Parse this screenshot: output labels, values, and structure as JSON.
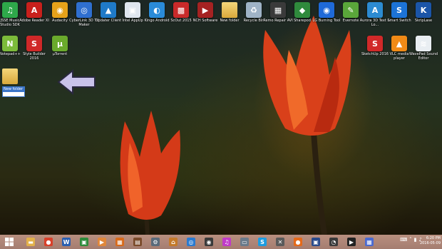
{
  "desktop_icons": [
    {
      "label": "JSSE Music Studio SDK",
      "icon": "music-app-icon",
      "color": "#2ea84a",
      "glyph": "♫"
    },
    {
      "label": "Adobe Reader XI",
      "icon": "adobe-reader-icon",
      "color": "#c8201c",
      "glyph": "A"
    },
    {
      "label": "Audacity",
      "icon": "audacity-icon",
      "color": "#e6a21a",
      "glyph": "◉"
    },
    {
      "label": "CyberLink 3D TV Maker",
      "icon": "cyberlink-icon",
      "color": "#2f6fd0",
      "glyph": "◎"
    },
    {
      "label": "Updater Client",
      "icon": "updater-icon",
      "color": "#1f7ac8",
      "glyph": "▲"
    },
    {
      "label": "Intel AppUp",
      "icon": "intel-icon",
      "color": "#dfe6ef",
      "glyph": "▣"
    },
    {
      "label": "Kingo Android",
      "icon": "kingo-icon",
      "color": "#2a8bd8",
      "glyph": "◐"
    },
    {
      "label": "ScOut 2015",
      "icon": "scout-icon",
      "color": "#c92a2a",
      "glyph": "▩"
    },
    {
      "label": "NCH Software",
      "icon": "nch-icon",
      "color": "#a52222",
      "glyph": "▶"
    },
    {
      "label": "New folder",
      "icon": "folder-icon",
      "color": "#e2b04a",
      "glyph": ""
    },
    {
      "label": "Recycle Bin",
      "icon": "recycle-bin-icon",
      "color": "#9fb3c6",
      "glyph": "♻"
    },
    {
      "label": "Remo Repair AVI",
      "icon": "remo-repair-icon",
      "color": "#3a3a3a",
      "glyph": "▦"
    },
    {
      "label": "Sharepod",
      "icon": "sharepod-icon",
      "color": "#2f8a3c",
      "glyph": "◆"
    },
    {
      "label": "LG Burning Tool",
      "icon": "lg-burning-icon",
      "color": "#1f6ad8",
      "glyph": "◉"
    },
    {
      "label": "Evernote",
      "icon": "evernote-icon",
      "color": "#5aa63a",
      "glyph": "✎"
    },
    {
      "label": "Aurora 3D Text & Lo...",
      "icon": "aurora-3d-icon",
      "color": "#2c8bd2",
      "glyph": "A"
    },
    {
      "label": "Smart Switch",
      "icon": "smart-switch-icon",
      "color": "#1c73d6",
      "glyph": "S"
    },
    {
      "label": "SkripLase",
      "icon": "skriplase-icon",
      "color": "#1b55a8",
      "glyph": "K"
    },
    {
      "label": "Notepad++",
      "icon": "notepad-plus-icon",
      "color": "#7cbb3a",
      "glyph": "N"
    },
    {
      "label": "Style Builder 2016",
      "icon": "style-builder-icon",
      "color": "#d02828",
      "glyph": "S"
    },
    {
      "label": "µTorrent",
      "icon": "utorrent-icon",
      "color": "#6aaa2c",
      "glyph": "µ"
    },
    {
      "label": "SketchUp 2016",
      "icon": "sketchup-icon",
      "color": "#d12929",
      "glyph": "S"
    },
    {
      "label": "VLC media player",
      "icon": "vlc-icon",
      "color": "#f08a16",
      "glyph": "▲"
    },
    {
      "label": "WavePad Sound Editor",
      "icon": "wavepad-icon",
      "color": "#e9eef2",
      "glyph": "≋"
    },
    {
      "label": "",
      "icon": "folder-icon",
      "color": "#e2b04a",
      "glyph": ""
    }
  ],
  "rename_box": {
    "value": "New folder"
  },
  "taskbar": {
    "start_icon": "windows-start-icon",
    "items": [
      {
        "name": "file-explorer",
        "icon": "file-explorer-icon",
        "color": "#e2b04a",
        "glyph": "▬"
      },
      {
        "name": "chrome",
        "icon": "chrome-icon",
        "color": "#d8402a",
        "glyph": "●"
      },
      {
        "name": "word",
        "icon": "word-icon",
        "color": "#2b5fb0",
        "glyph": "W"
      },
      {
        "name": "app-green",
        "icon": "green-app-icon",
        "color": "#2e8b3a",
        "glyph": "▣"
      },
      {
        "name": "media",
        "icon": "media-icon",
        "color": "#e0873a",
        "glyph": "▶"
      },
      {
        "name": "app-orange",
        "icon": "orange-app-icon",
        "color": "#d86a1a",
        "glyph": "▦"
      },
      {
        "name": "photo",
        "icon": "photo-icon",
        "color": "#7a4a2a",
        "glyph": "▤"
      },
      {
        "name": "settings",
        "icon": "gear-icon",
        "color": "#5a6a7a",
        "glyph": "⚙"
      },
      {
        "name": "hat",
        "icon": "hat-icon",
        "color": "#c47a2a",
        "glyph": "⌂"
      },
      {
        "name": "globe",
        "icon": "globe-icon",
        "color": "#2a7ad0",
        "glyph": "◎"
      },
      {
        "name": "disc",
        "icon": "disc-icon",
        "color": "#3a3a3a",
        "glyph": "◉"
      },
      {
        "name": "itunes",
        "icon": "itunes-icon",
        "color": "#c03ac8",
        "glyph": "♫"
      },
      {
        "name": "inbox",
        "icon": "inbox-icon",
        "color": "#6a7a8a",
        "glyph": "▭"
      },
      {
        "name": "skype",
        "icon": "skype-icon",
        "color": "#1c9ce0",
        "glyph": "S"
      },
      {
        "name": "tools",
        "icon": "tools-icon",
        "color": "#5a5a5a",
        "glyph": "✕"
      },
      {
        "name": "firefox",
        "icon": "firefox-icon",
        "color": "#e56a1a",
        "glyph": "●"
      },
      {
        "name": "monitor",
        "icon": "monitor-icon",
        "color": "#2a4a8a",
        "glyph": "▣"
      },
      {
        "name": "speedometer",
        "icon": "speedometer-icon",
        "color": "#3a3a3a",
        "glyph": "◔"
      },
      {
        "name": "media-player",
        "icon": "media-player-icon",
        "color": "#222222",
        "glyph": "▶"
      },
      {
        "name": "apps",
        "icon": "apps-icon",
        "color": "#4a6ad0",
        "glyph": "▦"
      }
    ],
    "tray": [
      {
        "icon": "keyboard-icon",
        "glyph": "⌨"
      },
      {
        "icon": "chevron-up-icon",
        "glyph": "˄"
      },
      {
        "icon": "network-icon",
        "glyph": "▮"
      },
      {
        "icon": "volume-icon",
        "glyph": "♪"
      }
    ],
    "clock_time": "6:20 PM",
    "clock_date": "2016-05-09"
  }
}
